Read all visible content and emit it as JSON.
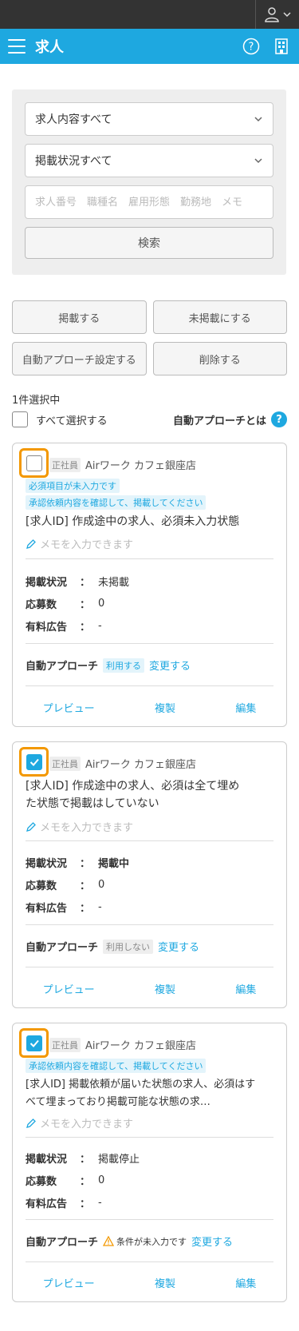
{
  "header": {
    "title": "求人"
  },
  "search": {
    "content_select": "求人内容すべて",
    "status_select": "掲載状況すべて",
    "keyword_placeholder": "求人番号　職種名　雇用形態　勤務地　メモ",
    "search_label": "検索"
  },
  "actions": {
    "publish": "掲載する",
    "unpublish": "未掲載にする",
    "auto_approach_set": "自動アプローチ設定する",
    "delete": "削除する"
  },
  "selection": {
    "count_text": "1件選択中",
    "select_all": "すべて選択する",
    "about_auto": "自動アプローチとは"
  },
  "labels": {
    "status": "掲載状況",
    "applicants": "応募数",
    "paid_ad": "有料広告",
    "colon": "：",
    "auto_approach": "自動アプローチ",
    "change": "変更する",
    "memo_placeholder": "メモを入力できます",
    "preview": "プレビュー",
    "copy": "複製",
    "edit": "編集"
  },
  "cards": [
    {
      "checked": false,
      "employment": "正社員",
      "shop": "Airワーク カフェ銀座店",
      "tags": [
        "必須項目が未入力です",
        "承認依頼内容を確認して、掲載してください"
      ],
      "title": "[求人ID] 作成途中の求人、必須未入力状態",
      "status": "未掲載",
      "applicants": "0",
      "paid_ad": "-",
      "auto_state": "利用する"
    },
    {
      "checked": true,
      "employment": "正社員",
      "shop": "Airワーク カフェ銀座店",
      "tags": [],
      "title_line1": "[求人ID] 作成途中の求人、必須は全て埋め",
      "title_line2": "た状態で掲載はしていない",
      "status": "掲載中",
      "applicants": "0",
      "paid_ad": "-",
      "auto_state": "利用しない"
    },
    {
      "checked": true,
      "employment": "正社員",
      "shop": "Airワーク カフェ銀座店",
      "tags": [
        "承認依頼内容を確認して、掲載してください"
      ],
      "title_line1": "[求人ID] 掲載依頼が届いた状態の求人、必須はす",
      "title_line2": "べて埋まっており掲載可能な状態の求…",
      "status": "掲載停止",
      "applicants": "0",
      "paid_ad": "-",
      "auto_state": "条件が未入力です"
    }
  ],
  "colors": {
    "accent": "#1ea8e0",
    "highlight": "#f39800",
    "topbar": "#333333"
  }
}
